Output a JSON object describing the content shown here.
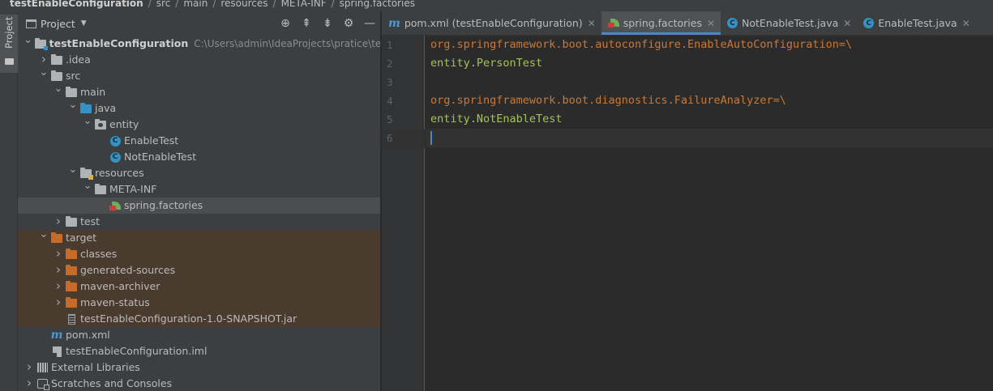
{
  "breadcrumb": [
    "testEnableConfiguration",
    "src",
    "main",
    "resources",
    "META-INF",
    "spring.factories"
  ],
  "toolstrip": {
    "project_label": "Project"
  },
  "panel": {
    "title": "Project",
    "actions": [
      "locate-icon",
      "expand-all-icon",
      "collapse-all-icon",
      "gear-icon",
      "minimize-icon"
    ]
  },
  "tree": [
    {
      "label": "testEnableConfiguration",
      "path": "C:\\Users\\admin\\IdeaProjects\\pratice\\testEn",
      "depth": 0,
      "arrow": "open",
      "icon": "module-folder",
      "bold": true
    },
    {
      "label": ".idea",
      "depth": 1,
      "arrow": "closed",
      "icon": "folder-gray"
    },
    {
      "label": "src",
      "depth": 1,
      "arrow": "open",
      "icon": "folder-gray"
    },
    {
      "label": "main",
      "depth": 2,
      "arrow": "open",
      "icon": "folder-gray"
    },
    {
      "label": "java",
      "depth": 3,
      "arrow": "open",
      "icon": "folder-blue"
    },
    {
      "label": "entity",
      "depth": 4,
      "arrow": "open",
      "icon": "package"
    },
    {
      "label": "EnableTest",
      "depth": 5,
      "arrow": "none",
      "icon": "class"
    },
    {
      "label": "NotEnableTest",
      "depth": 5,
      "arrow": "none",
      "icon": "class"
    },
    {
      "label": "resources",
      "depth": 3,
      "arrow": "open",
      "icon": "folder-resources"
    },
    {
      "label": "META-INF",
      "depth": 4,
      "arrow": "open",
      "icon": "folder-gray"
    },
    {
      "label": "spring.factories",
      "depth": 5,
      "arrow": "none",
      "icon": "spring",
      "selected": true
    },
    {
      "label": "test",
      "depth": 2,
      "arrow": "closed",
      "icon": "folder-gray"
    },
    {
      "label": "target",
      "depth": 1,
      "arrow": "open",
      "icon": "folder-orange",
      "excluded": true
    },
    {
      "label": "classes",
      "depth": 2,
      "arrow": "closed",
      "icon": "folder-orange",
      "excluded": true
    },
    {
      "label": "generated-sources",
      "depth": 2,
      "arrow": "closed",
      "icon": "folder-orange",
      "excluded": true
    },
    {
      "label": "maven-archiver",
      "depth": 2,
      "arrow": "closed",
      "icon": "folder-orange",
      "excluded": true
    },
    {
      "label": "maven-status",
      "depth": 2,
      "arrow": "closed",
      "icon": "folder-orange",
      "excluded": true
    },
    {
      "label": "testEnableConfiguration-1.0-SNAPSHOT.jar",
      "depth": 2,
      "arrow": "none",
      "icon": "jar",
      "excluded": true
    },
    {
      "label": "pom.xml",
      "depth": 1,
      "arrow": "none",
      "icon": "maven"
    },
    {
      "label": "testEnableConfiguration.iml",
      "depth": 1,
      "arrow": "none",
      "icon": "iml"
    },
    {
      "label": "External Libraries",
      "depth": 0,
      "arrow": "closed",
      "icon": "libraries"
    },
    {
      "label": "Scratches and Consoles",
      "depth": 0,
      "arrow": "closed",
      "icon": "scratches"
    }
  ],
  "tabs": [
    {
      "label": "pom.xml (testEnableConfiguration)",
      "icon": "maven",
      "active": false
    },
    {
      "label": "spring.factories",
      "icon": "spring",
      "active": true
    },
    {
      "label": "NotEnableTest.java",
      "icon": "class",
      "active": false
    },
    {
      "label": "EnableTest.java",
      "icon": "class",
      "active": false
    }
  ],
  "editor": {
    "current_line": 6,
    "lines": [
      {
        "n": "1",
        "key": "org.springframework.boot.autoconfigure.EnableAutoConfiguration",
        "op": "=\\",
        "value": ""
      },
      {
        "n": "2",
        "key": "",
        "op": "",
        "value": "entity.PersonTest"
      },
      {
        "n": "3",
        "key": "",
        "op": "",
        "value": ""
      },
      {
        "n": "4",
        "key": "org.springframework.boot.diagnostics.FailureAnalyzer",
        "op": "=\\",
        "value": ""
      },
      {
        "n": "5",
        "key": "",
        "op": "",
        "value": "entity.NotEnableTest"
      },
      {
        "n": "6",
        "key": "",
        "op": "",
        "value": ""
      }
    ]
  },
  "colors": {
    "accent": "#4a88c7",
    "key": "#cc7832",
    "value": "#a5c25c",
    "excluded_bg": "#4a3b2f"
  }
}
